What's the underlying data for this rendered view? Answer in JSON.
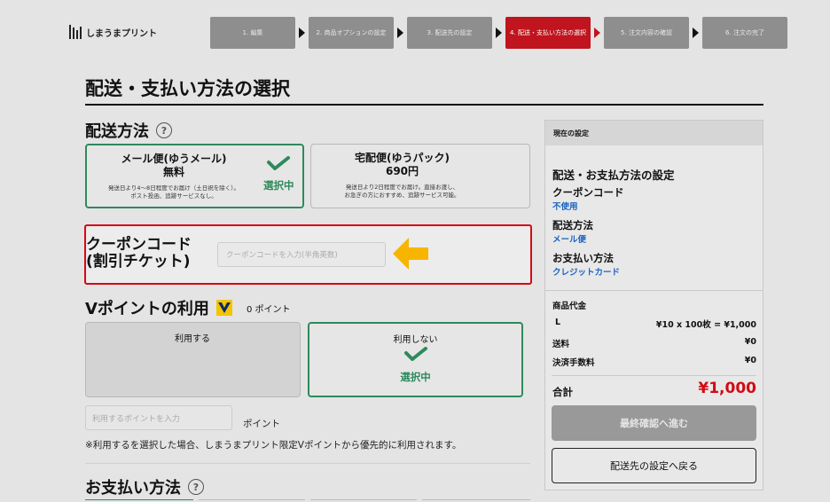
{
  "header": {
    "logo_text": "しまうまプリント",
    "steps": [
      {
        "label": "1. 編集"
      },
      {
        "label": "2. 商品オプションの設定"
      },
      {
        "label": "3. 配送先の設定"
      },
      {
        "label": "4. 配送・支払い方法の選択"
      },
      {
        "label": "5. 注文内容の確認"
      },
      {
        "label": "6. 注文の完了"
      }
    ],
    "active_step": 4
  },
  "page_title": "配送・支払い方法の選択",
  "shipping": {
    "title": "配送方法",
    "help_icon": "?",
    "options": [
      {
        "name": "メール便(ゆうメール)",
        "price": "無料",
        "note_line1": "発送日より4〜8日程度でお届け（土日祝を除く）。",
        "note_line2": "ポスト投函、追跡サービスなし。",
        "selected_label": "選択中",
        "selected": true
      },
      {
        "name": "宅配便(ゆうパック)",
        "price": "690円",
        "note_line1": "発送日より2日程度でお届け。直接お渡し、",
        "note_line2": "お急ぎの方におすすめ、追跡サービス可能。",
        "selected": false
      }
    ]
  },
  "coupon": {
    "label_line1": "クーポンコード",
    "label_line2": "(割引チケット)",
    "placeholder": "クーポンコードを入力(半角英数)"
  },
  "vpoint": {
    "title": "Vポイントの利用",
    "balance": "0 ポイント",
    "use_label": "利用する",
    "nouse_label": "利用しない",
    "selected_label": "選択中",
    "input_placeholder": "利用するポイントを入力",
    "unit": "ポイント",
    "note": "※利用するを選択した場合、しまうまプリント限定Vポイントから優先的に利用されます。"
  },
  "payment": {
    "title": "お支払い方法",
    "help_icon": "?"
  },
  "sidebar": {
    "header": "現在の設定",
    "title": "配送・お支払方法の設定",
    "coupon_label": "クーポンコード",
    "coupon_value": "不使用",
    "shipping_label": "配送方法",
    "shipping_value": "メール便",
    "payment_label": "お支払い方法",
    "payment_value": "クレジットカード",
    "product_label": "商品代金",
    "size": "L",
    "size_price": "¥10 x 100枚 = ¥1,000",
    "shipping_fee_label": "送料",
    "shipping_fee": "¥0",
    "payment_fee_label": "決済手数料",
    "payment_fee": "¥0",
    "total_label": "合計",
    "total": "¥1,000",
    "next_button": "最終確認へ進む",
    "back_button": "配送先の設定へ戻る"
  },
  "colors": {
    "accent_red": "#c0141e",
    "selected_green": "#2e8a5c",
    "link_blue": "#1a63c2",
    "arrow_yellow": "#f7b500"
  }
}
